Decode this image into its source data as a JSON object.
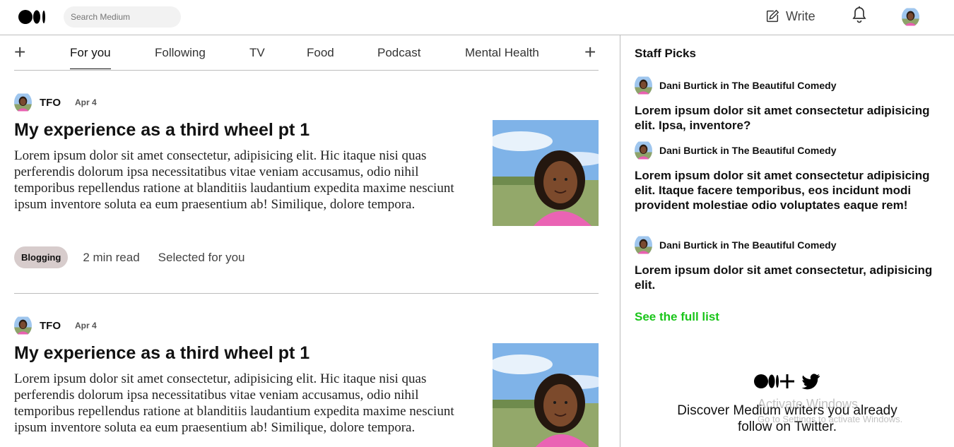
{
  "header": {
    "logo": "medium-logo",
    "search_placeholder": "Search Medium",
    "write_label": "Write",
    "icons": [
      "write-icon",
      "bell-icon",
      "avatar"
    ]
  },
  "tabs": {
    "items": [
      "For you",
      "Following",
      "TV",
      "Food",
      "Podcast",
      "Mental Health"
    ],
    "active": "For you"
  },
  "articles": [
    {
      "author": "TFO",
      "date": "Apr 4",
      "title": "My experience as a third wheel pt 1",
      "body": "Lorem ipsum dolor sit amet consectetur, adipisicing elit. Hic itaque nisi quas perferendis dolorum ipsa necessitatibus vitae veniam accusamus, odio nihil temporibus repellendus ratione at blanditiis laudantium expedita maxime nesciunt ipsum inventore soluta ea eum praesentium ab! Similique, dolore tempora.",
      "tag": "Blogging",
      "read_time": "2 min read",
      "selected": "Selected for you"
    },
    {
      "author": "TFO",
      "date": "Apr 4",
      "title": "My experience as a third wheel pt 1",
      "body": "Lorem ipsum dolor sit amet consectetur, adipisicing elit. Hic itaque nisi quas perferendis dolorum ipsa necessitatibus vitae veniam accusamus, odio nihil temporibus repellendus ratione at blanditiis laudantium expedita maxime nesciunt ipsum inventore soluta ea eum praesentium ab! Similique, dolore tempora."
    }
  ],
  "staff_picks": {
    "title": "Staff Picks",
    "items": [
      {
        "author": "Dani Burtick in The Beautiful Comedy",
        "title": "Lorem ipsum dolor sit amet consectetur adipisicing elit. Ipsa, inventore?"
      },
      {
        "author": "Dani Burtick in The Beautiful Comedy",
        "title": "Lorem ipsum dolor sit amet consectetur adipisicing elit. Itaque facere temporibus, eos incidunt modi provident molestiae odio voluptates eaque rem!"
      },
      {
        "author": "Dani Burtick in The Beautiful Comedy",
        "title": "Lorem ipsum dolor sit amet consectetur, adipisicing elit."
      }
    ],
    "see_full_list": "See the full list"
  },
  "discover": {
    "logos": [
      "medium-logo",
      "plus-icon",
      "twitter-icon"
    ],
    "text": "Discover Medium writers you already follow on Twitter."
  },
  "watermark": {
    "line1": "Activate Windows",
    "line2": "Go to Settings to activate Windows."
  },
  "colors": {
    "accent_green": "#1ac51a",
    "tag_background": "#d7cccc",
    "search_background": "#f2f2f2",
    "divider": "#bdbdbd"
  }
}
